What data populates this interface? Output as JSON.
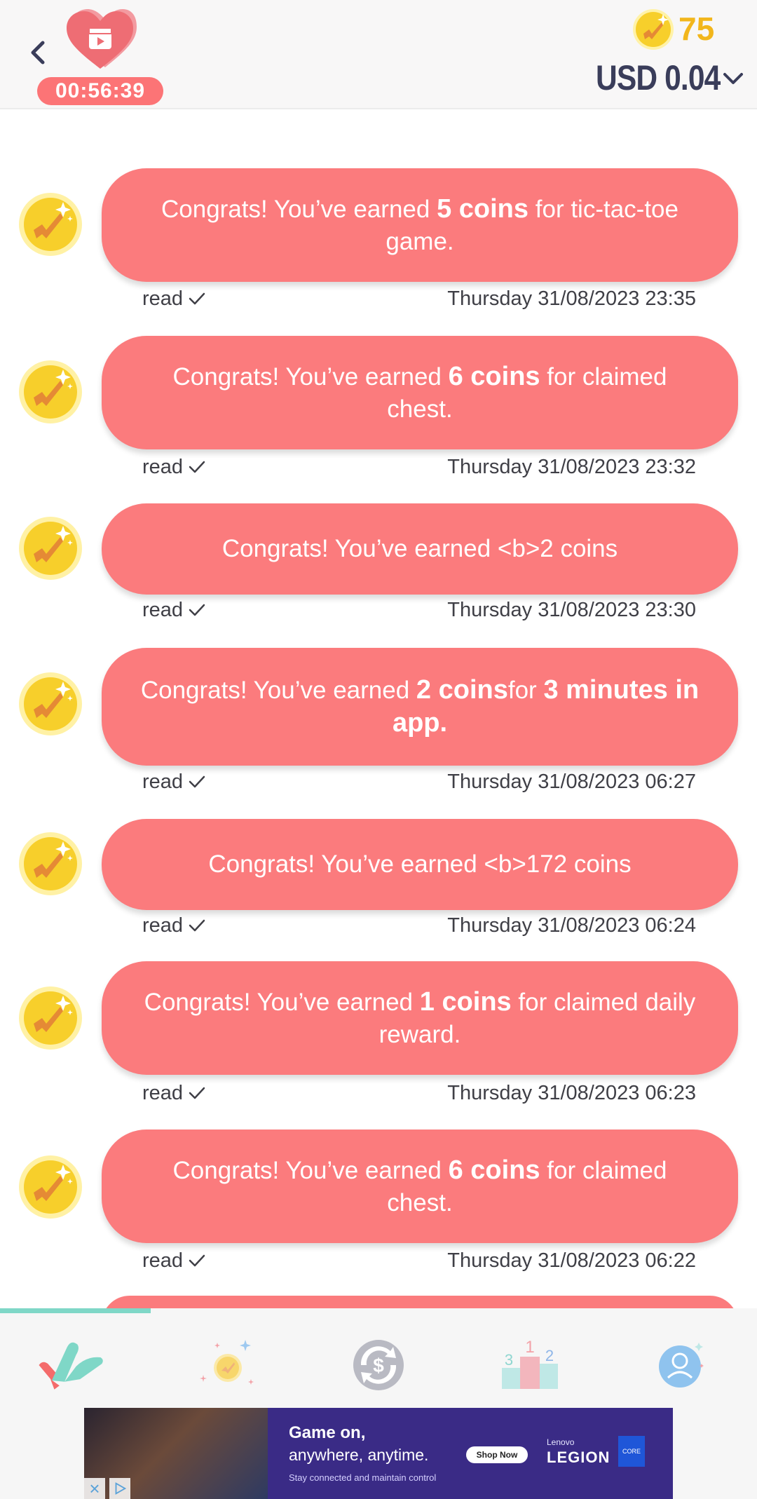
{
  "header": {
    "timer": "00:56:39",
    "coins": "75",
    "currency_value": "USD 0.04"
  },
  "messages": [
    {
      "prefix": "Congrats! You’ve earned ",
      "bold": "5 coins",
      "mid": " for tic-tac-toe game.",
      "bold2": "",
      "status": "read",
      "timestamp": "Thursday 31/08/2023 23:35"
    },
    {
      "prefix": "Congrats! You’ve earned ",
      "bold": "6 coins",
      "mid": " for claimed chest.",
      "bold2": "",
      "status": "read",
      "timestamp": "Thursday 31/08/2023 23:32"
    },
    {
      "prefix": "Congrats! You’ve earned <b>2 coins",
      "bold": "",
      "mid": "",
      "bold2": "",
      "status": "read",
      "timestamp": "Thursday 31/08/2023 23:30"
    },
    {
      "prefix": "Congrats! You’ve earned ",
      "bold": "2 coins",
      "mid": "for ",
      "bold2": "3 minutes in app.",
      "status": "read",
      "timestamp": "Thursday 31/08/2023 06:27"
    },
    {
      "prefix": "Congrats! You’ve earned <b>172 coins",
      "bold": "",
      "mid": "",
      "bold2": "",
      "status": "read",
      "timestamp": "Thursday 31/08/2023 06:24"
    },
    {
      "prefix": "Congrats! You’ve earned ",
      "bold": "1 coins",
      "mid": " for claimed daily reward.",
      "bold2": "",
      "status": "read",
      "timestamp": "Thursday 31/08/2023 06:23"
    },
    {
      "prefix": "Congrats! You’ve earned ",
      "bold": "6 coins",
      "mid": " for claimed chest.",
      "bold2": "",
      "status": "read",
      "timestamp": "Thursday 31/08/2023 06:22"
    }
  ],
  "nav": {
    "items": [
      "home",
      "bonus",
      "exchange",
      "leaderboard",
      "profile"
    ],
    "leaderboard_ranks": [
      "1",
      "2",
      "3"
    ]
  },
  "ad": {
    "headline": "Game on,",
    "subline": "anywhere, anytime.",
    "small_text": "Stay connected and maintain control",
    "cta": "Shop Now",
    "brand_top": "Lenovo",
    "brand": "LEGION",
    "chip": "CORE"
  },
  "colors": {
    "bubble": "#fb7b7d",
    "accent_teal": "#7fd7c7",
    "coin_gold": "#f2b61c",
    "text_dark": "#3a3d5a"
  },
  "icons": [
    "back-chevron-icon",
    "heart-video-icon",
    "coin-icon",
    "chevron-down-icon",
    "check-icon"
  ]
}
